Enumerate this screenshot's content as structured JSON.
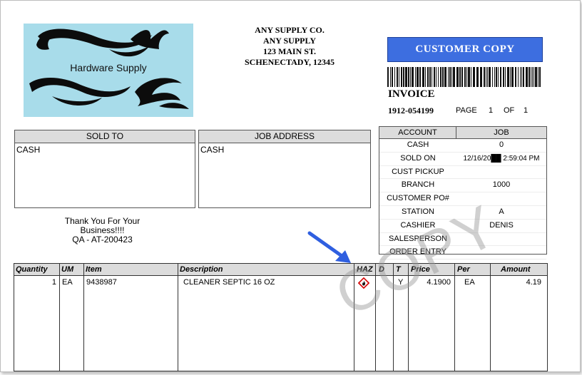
{
  "logo": {
    "text": "Hardware Supply"
  },
  "company": {
    "name": "ANY SUPPLY CO.",
    "line2": "ANY SUPPLY",
    "street": "123 MAIN ST.",
    "city": "SCHENECTADY,  12345"
  },
  "copy_button": {
    "label": "CUSTOMER COPY",
    "color": "#3d6ee0"
  },
  "invoice": {
    "label": "INVOICE",
    "number": "1912-054199",
    "page_label": "PAGE",
    "page": "1",
    "of_label": "OF",
    "of": "1"
  },
  "sold_to": {
    "header": "SOLD TO",
    "body": "CASH"
  },
  "job_address": {
    "header": "JOB ADDRESS",
    "body": "CASH"
  },
  "thanks": {
    "line1": "Thank You For Your",
    "line2": "Business!!!!",
    "line3": "QA - AT-200423"
  },
  "account": {
    "header_account": "ACCOUNT",
    "header_job": "JOB",
    "rows": [
      {
        "label": "CASH",
        "value": "0"
      },
      {
        "label": "SOLD ON",
        "value": "12/16/20██ 2:59:04 PM"
      },
      {
        "label": "CUST PICKUP",
        "value": ""
      },
      {
        "label": "BRANCH",
        "value": "1000"
      },
      {
        "label": "CUSTOMER PO#",
        "value": ""
      },
      {
        "label": "STATION",
        "value": "A"
      },
      {
        "label": "CASHIER",
        "value": "DENIS"
      },
      {
        "label": "SALESPERSON",
        "value": ""
      },
      {
        "label": "ORDER ENTRY",
        "value": ""
      }
    ]
  },
  "items": {
    "headers": {
      "quantity": "Quantity",
      "um": "UM",
      "item": "Item",
      "description": "Description",
      "haz": "HAZ",
      "d": "D",
      "t": "T",
      "price": "Price",
      "per": "Per",
      "amount": "Amount"
    },
    "rows": [
      {
        "quantity": "1",
        "um": "EA",
        "item": "9438987",
        "description": "CLEANER SEPTIC 16 OZ",
        "haz_icon": "flammable-hazard-icon",
        "d": "",
        "t": "Y",
        "price": "4.1900",
        "per": "EA",
        "amount": "4.19"
      }
    ]
  },
  "watermark": "COPY",
  "annotation_arrow_color": "#2f5fe0"
}
